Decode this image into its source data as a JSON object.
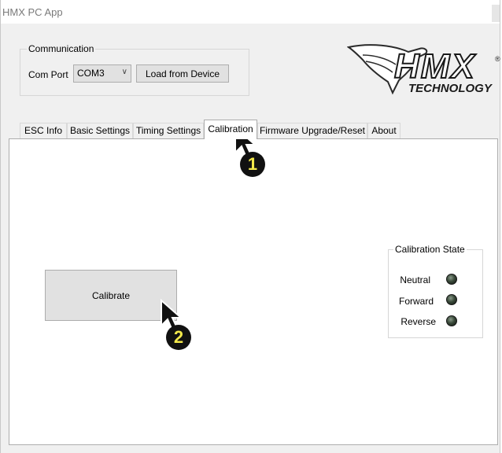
{
  "app": {
    "title": "HMX PC App"
  },
  "communication": {
    "group_label": "Communication",
    "com_port_label": "Com Port",
    "com_port_value": "COM3",
    "load_button_label": "Load from Device"
  },
  "logo": {
    "brand": "HMX",
    "sub": "TECHNOLOGY",
    "registered": "®"
  },
  "tabs": [
    {
      "label": "ESC Info"
    },
    {
      "label": "Basic Settings"
    },
    {
      "label": "Timing Settings"
    },
    {
      "label": "Calibration",
      "active": true
    },
    {
      "label": "Firmware Upgrade/Reset"
    },
    {
      "label": "About"
    }
  ],
  "calibration": {
    "button_label": "Calibrate",
    "state_group_label": "Calibration State",
    "states": [
      {
        "label": "Neutral"
      },
      {
        "label": "Forward"
      },
      {
        "label": "Reverse"
      }
    ]
  },
  "annotations": {
    "step1": "1",
    "step2": "2"
  },
  "icons": {
    "dropdown": "chevron-down-icon",
    "led": "led-indicator-icon",
    "cursor": "mouse-pointer-icon",
    "logo": "hummingbird-logo-icon"
  },
  "colors": {
    "badge_text": "#f2e84a",
    "led": "#2f3d2f"
  }
}
